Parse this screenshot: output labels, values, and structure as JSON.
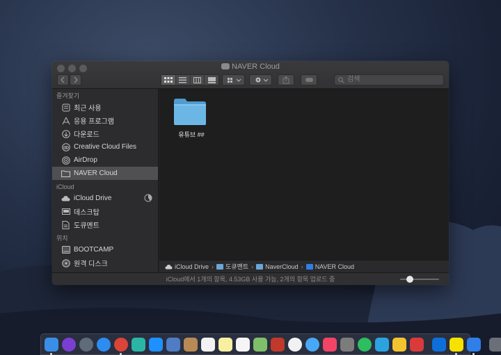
{
  "window": {
    "title": "NAVER Cloud",
    "search_placeholder": "검색"
  },
  "sidebar": {
    "sections": [
      {
        "header": "즐겨찾기",
        "items": [
          {
            "label": "최근 사용",
            "icon": "clock-icon"
          },
          {
            "label": "응용 프로그램",
            "icon": "applications-icon"
          },
          {
            "label": "다운로드",
            "icon": "download-icon"
          },
          {
            "label": "Creative Cloud Files",
            "icon": "creative-cloud-icon"
          },
          {
            "label": "AirDrop",
            "icon": "airdrop-icon"
          },
          {
            "label": "NAVER Cloud",
            "icon": "folder-icon",
            "selected": true
          }
        ]
      },
      {
        "header": "iCloud",
        "items": [
          {
            "label": "iCloud Drive",
            "icon": "icloud-icon",
            "progress": 0.4
          },
          {
            "label": "데스크탑",
            "icon": "desktop-icon"
          },
          {
            "label": "도큐멘트",
            "icon": "document-icon"
          }
        ]
      },
      {
        "header": "위치",
        "items": [
          {
            "label": "BOOTCAMP",
            "icon": "disk-icon"
          },
          {
            "label": "원격 디스크",
            "icon": "remote-disk-icon"
          }
        ]
      }
    ]
  },
  "content": {
    "items": [
      {
        "label": "유튜브 ##",
        "icon": "folder-icon"
      }
    ]
  },
  "pathbar": {
    "crumbs": [
      "iCloud Drive",
      "도큐멘트",
      "NaverCloud",
      "NAVER Cloud"
    ]
  },
  "status": {
    "text": "iCloud에서 1개의 항목, 4.53GB 사용 가능, 2개의 항목 업로드 중",
    "icon_size_level": 0.25
  },
  "dock": {
    "apps": [
      {
        "name": "finder-icon",
        "color": "#3a8ee6",
        "running": true
      },
      {
        "name": "siri-icon",
        "color": "#7a3fd0",
        "round": true
      },
      {
        "name": "launchpad-icon",
        "color": "#5f6a7a",
        "round": true
      },
      {
        "name": "safari-icon",
        "color": "#2d8cf0",
        "round": true
      },
      {
        "name": "chrome-icon",
        "color": "#db4437",
        "round": true,
        "running": true
      },
      {
        "name": "sketch-icon",
        "color": "#2bb5a5"
      },
      {
        "name": "app-store-icon",
        "color": "#1e90ff"
      },
      {
        "name": "preview-icon",
        "color": "#4f7cc4"
      },
      {
        "name": "contacts-icon",
        "color": "#b88a55"
      },
      {
        "name": "calendar-icon",
        "color": "#f2f2f2"
      },
      {
        "name": "notes-icon",
        "color": "#f8f0a0"
      },
      {
        "name": "reminders-icon",
        "color": "#f5f5f5"
      },
      {
        "name": "maps-icon",
        "color": "#7fbf6a"
      },
      {
        "name": "photo-booth-icon",
        "color": "#c0392b"
      },
      {
        "name": "photos-icon",
        "color": "#f1f1f1",
        "round": true
      },
      {
        "name": "messages-icon",
        "color": "#49a8f5",
        "round": true
      },
      {
        "name": "music-icon",
        "color": "#f14466"
      },
      {
        "name": "system-preferences-icon",
        "color": "#7c7c7c"
      },
      {
        "name": "evernote-icon",
        "color": "#2dbe60",
        "round": true
      },
      {
        "name": "notability-icon",
        "color": "#2aa3e0"
      },
      {
        "name": "notes-yellow-icon",
        "color": "#f4c430"
      },
      {
        "name": "pocket-icon",
        "color": "#d93a3a"
      },
      {
        "name": "teamviewer-icon",
        "color": "#0e6fdb",
        "separator_before": true
      },
      {
        "name": "kakaotalk-icon",
        "color": "#f7e100",
        "running": true
      },
      {
        "name": "naver-cloud-icon",
        "color": "#2f7fe8",
        "running": true
      },
      {
        "name": "trash-icon",
        "color": "#6b6f78",
        "separator_before": true
      }
    ]
  }
}
